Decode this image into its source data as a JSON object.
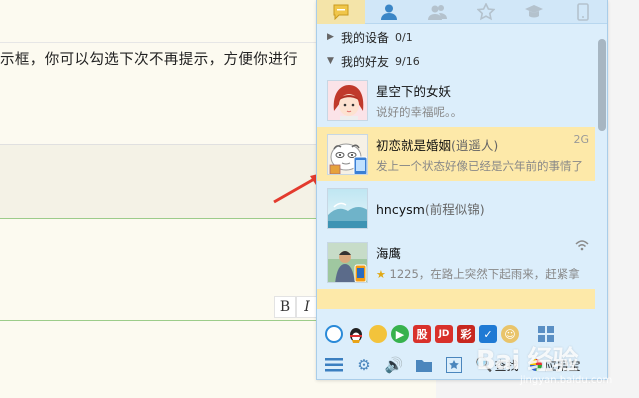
{
  "background": {
    "text_line": "示框，你可以勾选下次不再提示，方便你进行",
    "format_bold": "B",
    "format_italic": "I"
  },
  "tabs": [
    {
      "name": "message",
      "icon": "chat-bubble-icon",
      "active": true
    },
    {
      "name": "contacts",
      "icon": "person-icon",
      "active": false
    },
    {
      "name": "groups",
      "icon": "group-icon",
      "active": false
    },
    {
      "name": "favorites",
      "icon": "star-icon",
      "active": false
    },
    {
      "name": "education",
      "icon": "graduation-cap-icon",
      "active": false
    },
    {
      "name": "mobile",
      "icon": "phone-icon",
      "active": false
    }
  ],
  "groups": [
    {
      "label": "我的设备",
      "count": "0/1",
      "expanded": false
    },
    {
      "label": "我的好友",
      "count": "9/16",
      "expanded": true
    }
  ],
  "contacts": [
    {
      "name": "星空下的女妖",
      "nick": "",
      "signature": "说好的幸福呢。。",
      "badge": "",
      "selected": false
    },
    {
      "name": "初恋就是婚姻",
      "nick": "(逍遥人)",
      "signature": "发上一个状态好像已经是六年前的事情了",
      "badge": "2G",
      "selected": true
    },
    {
      "name": "hncysm",
      "nick": "(前程似锦)",
      "signature": "",
      "badge": "",
      "selected": false
    },
    {
      "name": "海鹰",
      "nick": "",
      "signature": "1225，在路上突然下起雨来，赶紧拿",
      "badge": "",
      "selected": false
    }
  ],
  "bottom_apps": [
    "qq-browser-icon",
    "qq-pet-icon",
    "coin-icon",
    "video-icon",
    "stock-icon",
    "jd-icon",
    "lottery-icon",
    "security-icon",
    "game-icon",
    "app-grid-icon"
  ],
  "bottom_apps_text": {
    "stock": "股",
    "jd": "JD",
    "lottery": "彩"
  },
  "toolbar": {
    "find_label": "查找",
    "app_center_label": "应用宝"
  },
  "watermark": {
    "main": "Bai 经验",
    "sub": "jingyan.baidu.com"
  },
  "colors": {
    "panel_bg": "#dceefb",
    "selected_row": "#fde9a9",
    "active_tab": "#f4e4a9",
    "accent_blue": "#4b86bd"
  }
}
